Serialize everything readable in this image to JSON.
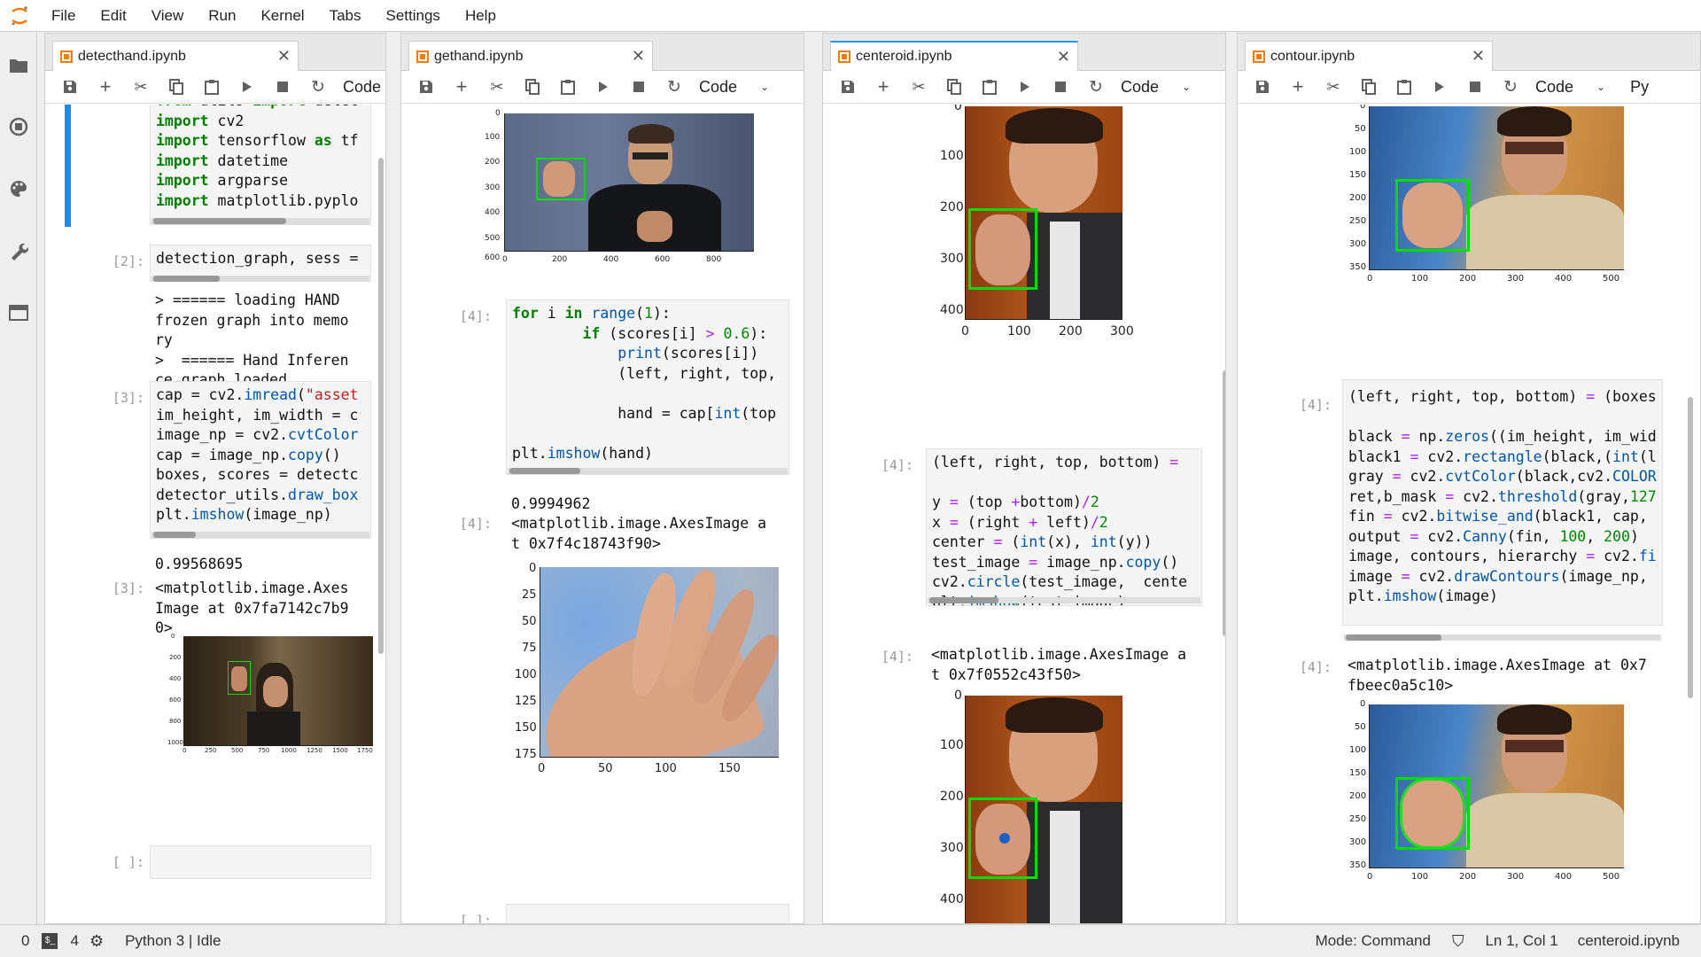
{
  "menubar": {
    "items": [
      "File",
      "Edit",
      "View",
      "Run",
      "Kernel",
      "Tabs",
      "Settings",
      "Help"
    ]
  },
  "sidebar": {
    "icons": [
      "folder-icon",
      "running-icon",
      "palette-icon",
      "wrench-icon",
      "tabs-icon"
    ]
  },
  "toolbar": {
    "cell_type": "Code",
    "cell_type_partial": "Py"
  },
  "colors": {
    "accent": "#2196f3",
    "tab_icon": "#f57c00",
    "kernel_bar": "#1e88e5",
    "bbox": "#00dd00",
    "centroid": "#1f5fbf"
  },
  "panels": [
    {
      "tab": "detecthand.ipynb",
      "code1": [
        "from utils import detec",
        "import cv2",
        "import tensorflow as tf",
        "import datetime",
        "import argparse",
        "import matplotlib.pyplo"
      ],
      "prompt2": "[2]:",
      "code2": "detection_graph, sess =",
      "out2": "> ====== loading HAND\nfrozen graph into memo\nry\n>  ====== Hand Inferen\nce graph loaded.",
      "prompt3": "[3]:",
      "code3": [
        "cap = cv2.imread(\"asset",
        "im_height, im_width = c",
        "image_np = cv2.cvtColor",
        "cap = image_np.copy()",
        "boxes, scores = detectc",
        "detector_utils.draw_box",
        "plt.imshow(image_np)"
      ],
      "out3a": "0.99568695",
      "out_prompt3": "[3]:",
      "out3b": "<matplotlib.image.Axes\nImage at 0x7fa7142c7b9\n0>",
      "yticks": [
        "0",
        "200",
        "400",
        "600",
        "800",
        "1000"
      ],
      "xticks": [
        "0",
        "250",
        "500",
        "750",
        "1000",
        "1250",
        "1500",
        "1750"
      ],
      "prompt_empty": "[ ]:"
    },
    {
      "tab": "gethand.ipynb",
      "yticks": [
        "0",
        "100",
        "200",
        "300",
        "400",
        "500",
        "600"
      ],
      "xticks": [
        "0",
        "200",
        "400",
        "600",
        "800"
      ],
      "prompt4": "[4]:",
      "code4": [
        "for i in range(1):",
        "        if (scores[i] > 0.6):",
        "            print(scores[i])",
        "            (left, right, top,",
        "",
        "            hand = cap[int(top",
        "",
        "plt.imshow(hand)"
      ],
      "out4a": "0.9994962",
      "out_prompt4": "[4]:",
      "out4b": "<matplotlib.image.AxesImage a\nt 0x7f4c18743f90>",
      "hand_yticks": [
        "0",
        "25",
        "50",
        "75",
        "100",
        "125",
        "150",
        "175"
      ],
      "hand_xticks": [
        "0",
        "50",
        "100",
        "150"
      ],
      "prompt_empty": "[ ]:"
    },
    {
      "tab": "centeroid.ipynb",
      "yticks": [
        "0",
        "100",
        "200",
        "300",
        "400"
      ],
      "xticks": [
        "0",
        "100",
        "200",
        "300"
      ],
      "prompt4": "[4]:",
      "code4": [
        "(left, right, top, bottom) =",
        "",
        "y = (top +bottom)/2",
        "x = (right + left)/2",
        "center = (int(x), int(y))",
        "test_image = image_np.copy()",
        "cv2.circle(test_image,  cente",
        "plt.imshow(test_image)"
      ],
      "out_prompt4": "[4]:",
      "out4b": "<matplotlib.image.AxesImage a\nt 0x7f0552c43f50>",
      "yticks2": [
        "0",
        "100",
        "200",
        "300",
        "400"
      ]
    },
    {
      "tab": "contour.ipynb",
      "yticks": [
        "0",
        "50",
        "100",
        "150",
        "200",
        "250",
        "300",
        "350"
      ],
      "xticks": [
        "0",
        "100",
        "200",
        "300",
        "400",
        "500"
      ],
      "prompt4": "[4]:",
      "code4": [
        "(left, right, top, bottom) = (boxes",
        "",
        "black = np.zeros((im_height, im_wid",
        "black1 = cv2.rectangle(black,(int(l",
        "gray = cv2.cvtColor(black,cv2.COLOR",
        "ret,b_mask = cv2.threshold(gray,127",
        "fin = cv2.bitwise_and(black1, cap,",
        "output = cv2.Canny(fin, 100, 200)",
        "image, contours, hierarchy = cv2.fi",
        "image = cv2.drawContours(image_np,",
        "plt.imshow(image)"
      ],
      "out_prompt4": "[4]:",
      "out4b": "<matplotlib.image.AxesImage at 0x7\nfbeec0a5c10>"
    }
  ],
  "statusbar": {
    "zero": "0",
    "terminals": "4",
    "kernel": "Python 3 | Idle",
    "mode": "Mode: Command",
    "position": "Ln 1, Col 1",
    "file": "centeroid.ipynb"
  }
}
